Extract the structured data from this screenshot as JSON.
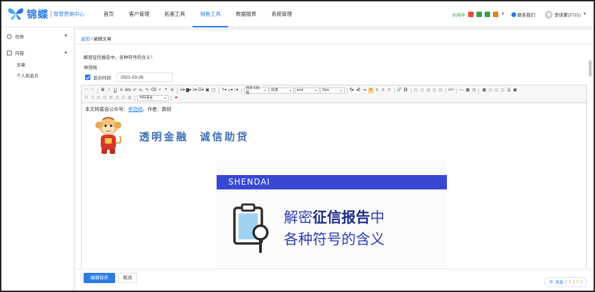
{
  "brand": {
    "name": "锦蝶",
    "subtitle": "智慧营销中心"
  },
  "nav": [
    {
      "label": "首页",
      "active": false
    },
    {
      "label": "客户管理",
      "active": false
    },
    {
      "label": "拓客工具",
      "active": false
    },
    {
      "label": "销售工具",
      "active": true
    },
    {
      "label": "数据报表",
      "active": false
    },
    {
      "label": "系统管理",
      "active": false
    }
  ],
  "topbar": {
    "status": "水闲中",
    "status_icon_colors": [
      "#e74c3c",
      "#3aa04a",
      "#3aa04a",
      "#e67e22"
    ],
    "contact": "联系我们",
    "user": "李佳蒙(2721)"
  },
  "sidebar": {
    "groups": [
      {
        "label": "任务",
        "icon": "task-icon",
        "expanded": false,
        "items": []
      },
      {
        "label": "内容",
        "icon": "content-icon",
        "expanded": true,
        "items": [
          "文章",
          "个人风名片"
        ]
      }
    ]
  },
  "breadcrumb": {
    "parent": "返回",
    "separator": "/",
    "current": "编辑文章"
  },
  "form": {
    "title": "解密征信报告中，各种符号的含义！",
    "author": "申贷网",
    "show_time_label": "显示时间",
    "show_time_checked": true,
    "date": "2021-03-26"
  },
  "toolbar": {
    "paragraph_format": "自定义标题",
    "paragraph": "段落",
    "font_family": "arial",
    "font_size": "16px",
    "code_lang": "代码语言"
  },
  "article": {
    "source_prefix": "本文转载自公众号：",
    "source_name": "申贷网",
    "author_label": "，作者：数财",
    "slogan": "透明金融  诚信助贷",
    "cover_tag": "SHENDAI",
    "cover_line1_a": "解密",
    "cover_line1_b": "征信报告",
    "cover_line1_c": "中",
    "cover_line2": "各种符号的含义"
  },
  "footer": {
    "save": "编辑保存",
    "cancel": "取消"
  },
  "messages": {
    "label": "消息",
    "count1": "0",
    "count2": "0"
  }
}
